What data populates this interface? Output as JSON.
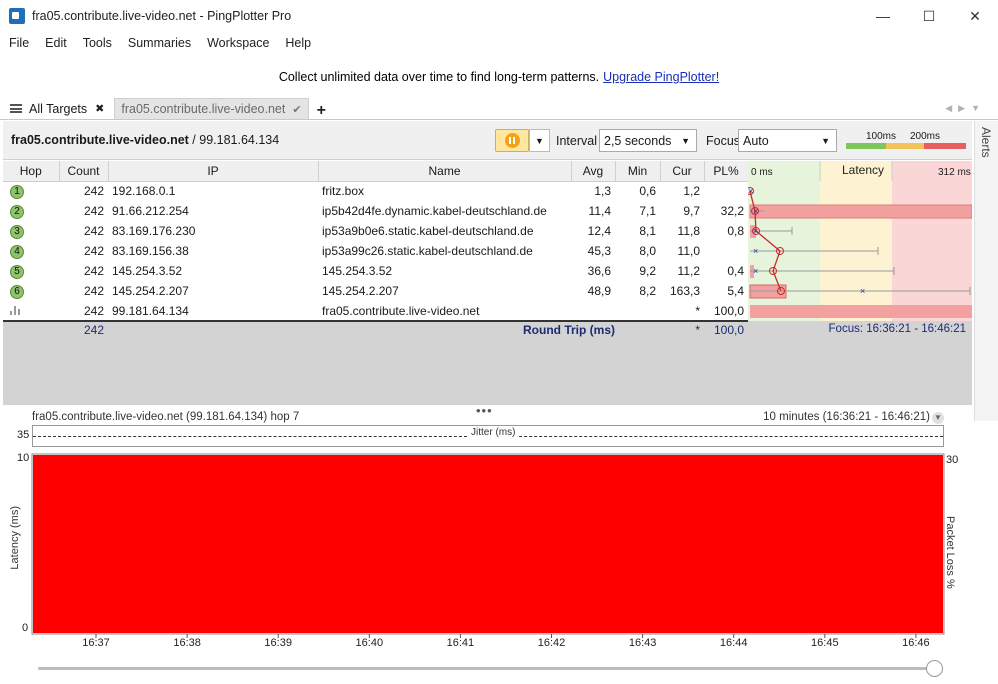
{
  "window": {
    "title": "fra05.contribute.live-video.net - PingPlotter Pro"
  },
  "menu": [
    "File",
    "Edit",
    "Tools",
    "Summaries",
    "Workspace",
    "Help"
  ],
  "promo": {
    "text": "Collect unlimited data over time to find long-term patterns.",
    "link": "Upgrade PingPlotter!"
  },
  "tabs": {
    "all": "All Targets",
    "active": "fra05.contribute.live-video.net"
  },
  "target": {
    "host": "fra05.contribute.live-video.net",
    "ip_suffix": " / 99.181.64.134"
  },
  "toolbar": {
    "interval_label": "Interval",
    "interval_value": "2,5 seconds",
    "focus_label": "Focus",
    "focus_value": "Auto",
    "scale_100": "100ms",
    "scale_200": "200ms"
  },
  "alerts": "Alerts",
  "columns": [
    "Hop",
    "Count",
    "IP",
    "Name",
    "Avg",
    "Min",
    "Cur",
    "PL%"
  ],
  "latency_header": {
    "start": "0 ms",
    "title": "Latency",
    "end": "312 ms"
  },
  "hops": [
    {
      "hop": "1",
      "count": "242",
      "ip": "192.168.0.1",
      "name": "fritz.box",
      "avg": "1,3",
      "min": "0,6",
      "cur": "1,2",
      "pl": ""
    },
    {
      "hop": "2",
      "count": "242",
      "ip": "91.66.212.254",
      "name": "ip5b42d4fe.dynamic.kabel-deutschland.de",
      "avg": "11,4",
      "min": "7,1",
      "cur": "9,7",
      "pl": "32,2"
    },
    {
      "hop": "3",
      "count": "242",
      "ip": "83.169.176.230",
      "name": "ip53a9b0e6.static.kabel-deutschland.de",
      "avg": "12,4",
      "min": "8,1",
      "cur": "11,8",
      "pl": "0,8"
    },
    {
      "hop": "4",
      "count": "242",
      "ip": "83.169.156.38",
      "name": "ip53a99c26.static.kabel-deutschland.de",
      "avg": "45,3",
      "min": "8,0",
      "cur": "11,0",
      "pl": ""
    },
    {
      "hop": "5",
      "count": "242",
      "ip": "145.254.3.52",
      "name": "145.254.3.52",
      "avg": "36,6",
      "min": "9,2",
      "cur": "11,2",
      "pl": "0,4"
    },
    {
      "hop": "6",
      "count": "242",
      "ip": "145.254.2.207",
      "name": "145.254.2.207",
      "avg": "48,9",
      "min": "8,2",
      "cur": "163,3",
      "pl": "5,4"
    },
    {
      "hop": "",
      "count": "242",
      "ip": "99.181.64.134",
      "name": "fra05.contribute.live-video.net",
      "avg": "",
      "min": "",
      "cur": "*",
      "pl": "100,0"
    }
  ],
  "summary": {
    "count": "242",
    "label": "Round Trip (ms)",
    "cur": "*",
    "pl": "100,0",
    "focus": "Focus: 16:36:21 - 16:46:21"
  },
  "lower": {
    "title": "fra05.contribute.live-video.net (99.181.64.134) hop 7",
    "range": "10 minutes (16:36:21 - 16:46:21)",
    "jitter_label": "Jitter (ms)",
    "jitter_max": "35",
    "y_max": "10",
    "y_min": "0",
    "y2_max": "30",
    "y_title": "Latency (ms)",
    "y2_title": "Packet Loss %",
    "times": [
      "16:37",
      "16:38",
      "16:39",
      "16:40",
      "16:41",
      "16:42",
      "16:43",
      "16:44",
      "16:45",
      "16:46"
    ]
  },
  "colors": {
    "loss": "#ff0000",
    "hop_green": "#8ec26b",
    "latency_green": "#e6f4dc",
    "latency_yellow": "#fdf3d2",
    "latency_red": "#fbd6d6"
  }
}
